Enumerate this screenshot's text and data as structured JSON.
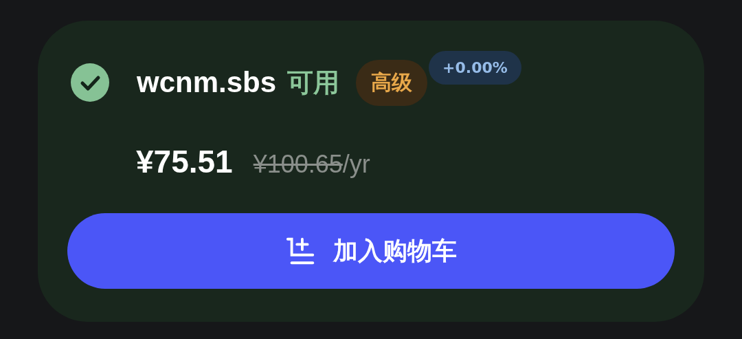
{
  "domain": {
    "name": "wcnm.sbs",
    "status": "可用",
    "available": true,
    "tier": "高级",
    "change": "+0.00%"
  },
  "price": {
    "current": "¥75.51",
    "original": "¥100.65",
    "period": "/yr"
  },
  "button": {
    "label": "加入购物车"
  }
}
